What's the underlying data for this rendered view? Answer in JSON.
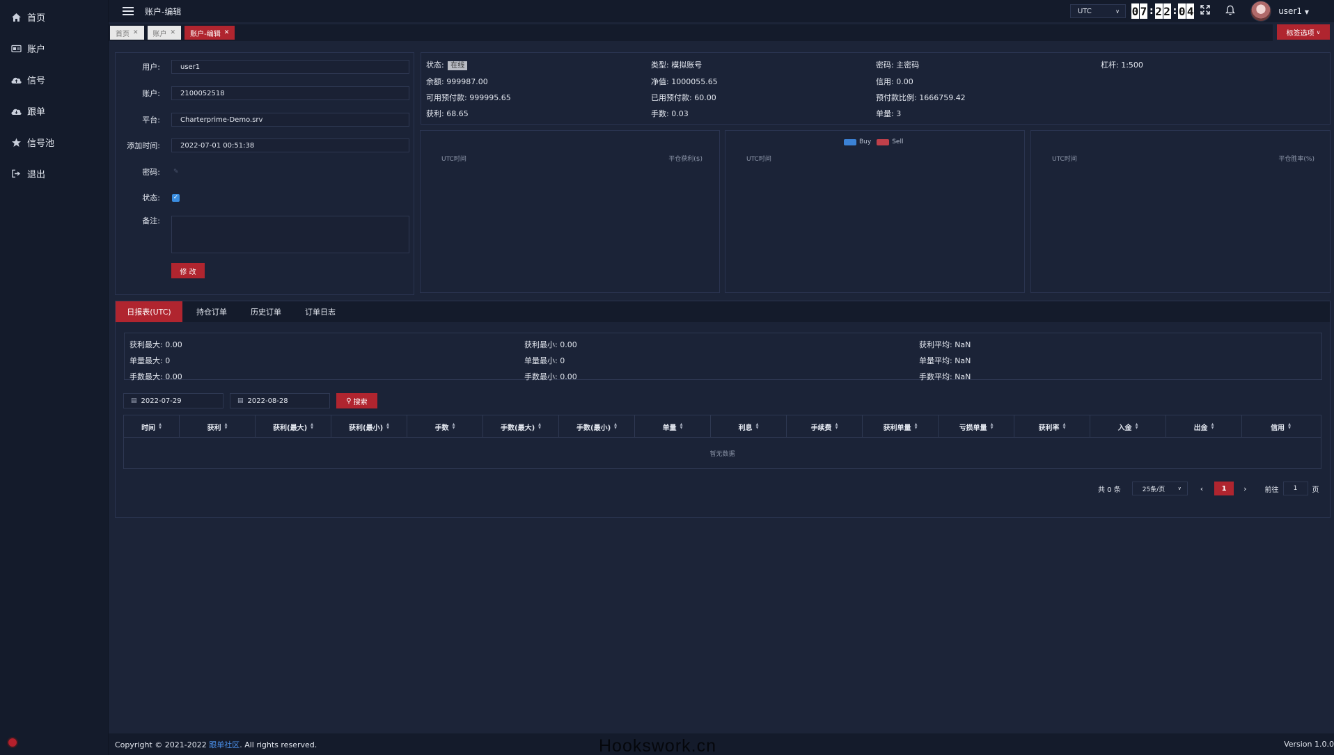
{
  "sidebar": {
    "items": [
      {
        "label": "首页",
        "icon": "home-icon"
      },
      {
        "label": "账户",
        "icon": "id-card-icon"
      },
      {
        "label": "信号",
        "icon": "cloud-upload-icon"
      },
      {
        "label": "跟单",
        "icon": "cloud-download-icon"
      },
      {
        "label": "信号池",
        "icon": "star-icon"
      },
      {
        "label": "退出",
        "icon": "sign-out-icon"
      }
    ]
  },
  "topbar": {
    "title": "账户-编辑",
    "timezone": "UTC",
    "clock": {
      "h1": "0",
      "h2": "7",
      "m1": "2",
      "m2": "2",
      "s1": "0",
      "s2": "4"
    },
    "user": "user1"
  },
  "tabs": {
    "items": [
      {
        "label": "首页"
      },
      {
        "label": "账户"
      },
      {
        "label": "账户-编辑"
      }
    ],
    "options_label": "标签选项"
  },
  "form": {
    "user_label": "用户:",
    "user_value": "user1",
    "account_label": "账户:",
    "account_value": "2100052518",
    "platform_label": "平台:",
    "platform_value": "Charterprime-Demo.srv",
    "added_label": "添加时间:",
    "added_value": "2022-07-01 00:51:38",
    "password_label": "密码:",
    "status_label": "状态:",
    "notes_label": "备注:",
    "submit_label": "修 改"
  },
  "info": {
    "status_label": "状态:",
    "status_value": "在线",
    "type": "类型:  模拟账号",
    "password": "密码:  主密码",
    "leverage": "杠杆:  1:500",
    "balance": "余额:  999987.00",
    "equity": "净值:  1000055.65",
    "credit": "信用:  0.00",
    "free_margin": "可用预付款:  999995.65",
    "used_margin": "已用预付款:  60.00",
    "margin_ratio": "预付款比例:  1666759.42",
    "profit": "获利:  68.65",
    "lots": "手数:  0.03",
    "orders": "单量:  3"
  },
  "charts": [
    {
      "xlabel": "UTC时间",
      "ylabel": "平仓获利($)"
    },
    {
      "xlabel": "UTC时间",
      "legend": [
        "Buy",
        "Sell"
      ],
      "colors": [
        "#3b82d6",
        "#c0404a"
      ]
    },
    {
      "xlabel": "UTC时间",
      "ylabel": "平仓胜率(%)"
    }
  ],
  "report": {
    "tabs": [
      "日报表(UTC)",
      "持仓订单",
      "历史订单",
      "订单日志"
    ],
    "stats": {
      "profit_max": "获利最大:  0.00",
      "profit_min": "获利最小:  0.00",
      "profit_avg": "获利平均:  NaN",
      "orders_max": "单量最大:  0",
      "orders_min": "单量最小:  0",
      "orders_avg": "单量平均:  NaN",
      "lots_max": "手数最大:  0.00",
      "lots_min": "手数最小:  0.00",
      "lots_avg": "手数平均:  NaN"
    },
    "date_from": "2022-07-29",
    "date_to": "2022-08-28",
    "search_label": "搜索",
    "columns": [
      "时间",
      "获利",
      "获利(最大)",
      "获利(最小)",
      "手数",
      "手数(最大)",
      "手数(最小)",
      "单量",
      "利息",
      "手续费",
      "获利单量",
      "亏损单量",
      "获利率",
      "入金",
      "出金",
      "信用"
    ],
    "empty_text": "暂无数据",
    "pagination": {
      "total": "共 0 条",
      "page_size": "25条/页",
      "current": "1",
      "goto_label": "前往",
      "goto_value": "1",
      "page_suffix": "页"
    }
  },
  "footer": {
    "copyright_prefix": "Copyright © 2021-2022 ",
    "link": "跟单社区",
    "suffix": ". All rights reserved.",
    "version": "Version 1.0.0",
    "watermark": "Hookswork.cn"
  },
  "colors": {
    "accent": "#b0252f",
    "background": "#1c2438",
    "sidebar": "#141b2b",
    "checkbox": "#3a8de0"
  }
}
